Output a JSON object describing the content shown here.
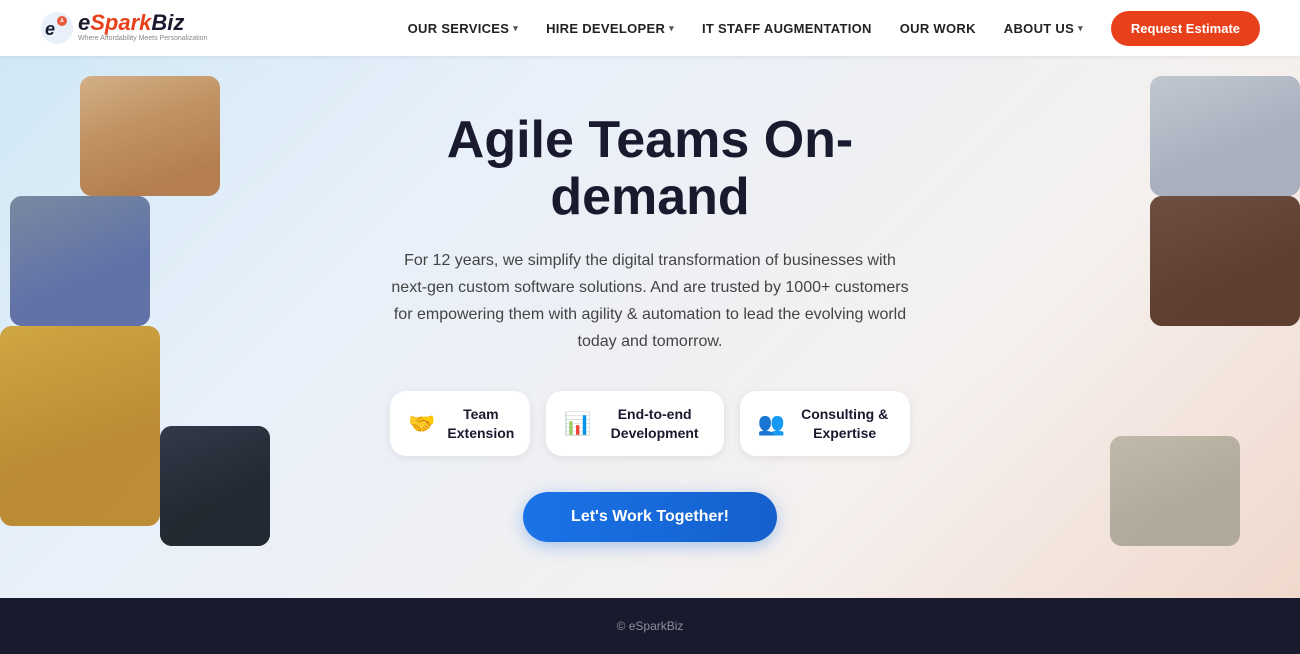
{
  "brand": {
    "name_e": "e",
    "name_spark": "Spark",
    "name_biz": "Biz",
    "tagline": "Where Affordability Meets Personalization"
  },
  "nav": {
    "links": [
      {
        "id": "our-services",
        "label": "OUR SERVICES",
        "has_dropdown": true
      },
      {
        "id": "hire-developer",
        "label": "HIRE DEVELOPER",
        "has_dropdown": true
      },
      {
        "id": "it-staff",
        "label": "IT STAFF AUGMENTATION",
        "has_dropdown": false
      },
      {
        "id": "our-work",
        "label": "OUR WORK",
        "has_dropdown": false
      },
      {
        "id": "about-us",
        "label": "ABOUT US",
        "has_dropdown": true
      }
    ],
    "cta_label": "Request Estimate"
  },
  "hero": {
    "title": "Agile Teams On-demand",
    "subtitle": "For 12 years, we simplify the digital transformation of businesses with next-gen custom software solutions. And are trusted by 1000+ customers for empowering them with agility & automation to lead the evolving world today and tomorrow.",
    "features": [
      {
        "id": "team-extension",
        "icon": "🤝",
        "label": "Team Extension"
      },
      {
        "id": "end-to-end",
        "icon": "📊",
        "label": "End-to-end Development"
      },
      {
        "id": "consulting",
        "icon": "👥",
        "label": "Consulting & Expertise"
      }
    ],
    "cta_label": "Let's Work Together!"
  },
  "footer": {
    "bg": "#1a1a2e"
  }
}
